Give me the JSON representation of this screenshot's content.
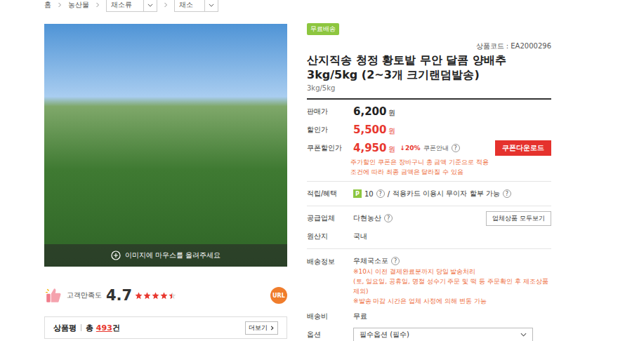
{
  "breadcrumb": {
    "home": "홈",
    "category": "농산물",
    "selects": [
      {
        "label": "채소류"
      },
      {
        "label": "채소"
      }
    ]
  },
  "image": {
    "hint": "이미지에 마우스를 올려주세요"
  },
  "rating": {
    "label": "고객만족도",
    "score": "4.7",
    "stars": 4.5
  },
  "url_badge": "URL",
  "reviews": {
    "label": "상품평",
    "count_prefix": "총",
    "count": "493",
    "count_suffix": "건",
    "more": "더보기"
  },
  "badge": "무료배송",
  "product_code": "상품코드 : EA2000296",
  "title": "산지직송 청정 황토밭 무안 달콤 양배추 3kg/5kg (2~3개 크기랜덤발송)",
  "subtitle": "3kg/5kg",
  "price": {
    "list": {
      "label": "판매가",
      "value": "6,200",
      "unit": "원"
    },
    "sale": {
      "label": "할인가",
      "value": "5,500",
      "unit": "원"
    },
    "coupon": {
      "label": "쿠폰할인가",
      "value": "4,950",
      "unit": "원",
      "discount": "↓20%",
      "info": "쿠폰안내",
      "help": "?",
      "button": "쿠폰다운로드"
    },
    "notes": [
      "주가할인 쿠폰은 장바구니 총 금액 기준으로 적용",
      "조건에 따라 최종 금액은 달라질 수 있음"
    ]
  },
  "benefits": {
    "label": "적립/혜택",
    "point_icon": "P",
    "points": "10",
    "help": "?",
    "sep": "/",
    "card": "적용카드 이용시 무이자 할부 가능",
    "card_help": "?"
  },
  "supplier": {
    "label": "공급업체",
    "name": "다현농산",
    "help": "?",
    "button": "업체상품 모두보기"
  },
  "origin": {
    "label": "원산지",
    "value": "국내"
  },
  "shipping": {
    "label": "배송정보",
    "carrier": "우체국소포",
    "help": "?",
    "notes": [
      "※10시 이전 결제완료분까지 당일 발송처리",
      "(토, 일요일, 공휴일, 명절 성수기 주문 및 떡 등 주문확인 후 제조상품 제외)",
      "※발송 마감 시간은 업체 사정에 의해 변동 가능"
    ]
  },
  "shipping_fee": {
    "label": "배송비",
    "value": "무료"
  },
  "option": {
    "label": "옵션",
    "placeholder": "필수옵션 (필수)"
  }
}
